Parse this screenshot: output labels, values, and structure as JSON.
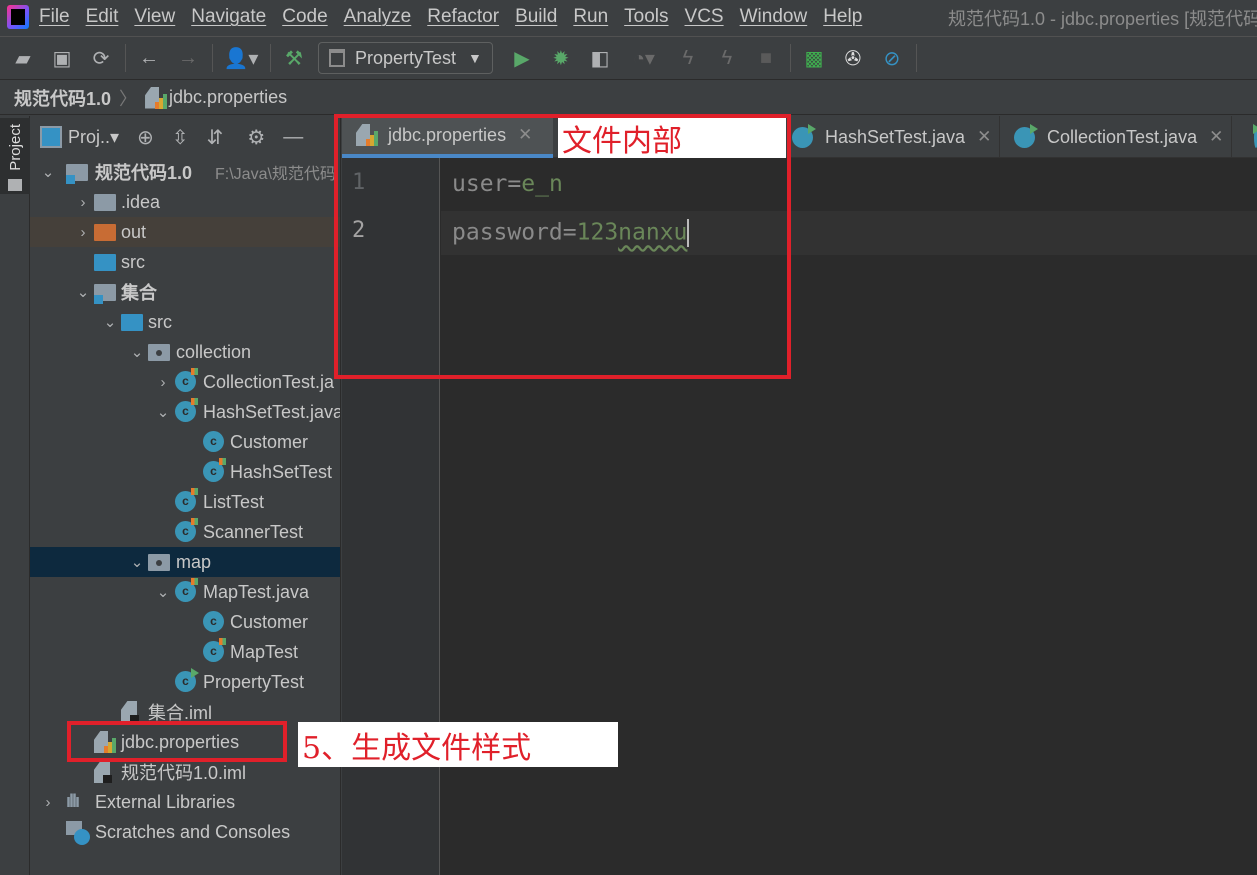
{
  "menubar": {
    "items": [
      "File",
      "Edit",
      "View",
      "Navigate",
      "Code",
      "Analyze",
      "Refactor",
      "Build",
      "Run",
      "Tools",
      "VCS",
      "Window",
      "Help"
    ],
    "window_title": "规范代码1.0 - jdbc.properties [规范代码"
  },
  "toolbar": {
    "run_config": "PropertyTest",
    "icons": [
      "open-icon",
      "save-icon",
      "sync-icon",
      "back-icon",
      "forward-icon",
      "user-icon",
      "build-icon",
      "run-icon",
      "debug-icon",
      "coverage-icon",
      "profile-icon",
      "attach-icon",
      "build-artifact-icon",
      "stop-icon",
      "monitor-icon",
      "plugins-icon",
      "no-icon"
    ]
  },
  "breadcrumb": {
    "project": "规范代码1.0",
    "file": "jdbc.properties"
  },
  "left_stripe": {
    "project_tab": "Project"
  },
  "project_panel": {
    "title": "Proj..▾",
    "tree": [
      {
        "label": "规范代码1.0",
        "path": "F:\\Java\\规范代码",
        "depth": 0,
        "expand": "open",
        "icon": "module-folder",
        "bold": true
      },
      {
        "label": ".idea",
        "depth": 1,
        "expand": "closed",
        "icon": "folder"
      },
      {
        "label": "out",
        "depth": 1,
        "expand": "closed",
        "icon": "folder-orange",
        "highlight": "out"
      },
      {
        "label": "src",
        "depth": 1,
        "expand": "none",
        "icon": "folder-src"
      },
      {
        "label": "集合",
        "depth": 1,
        "expand": "open",
        "icon": "module-folder",
        "bold": true
      },
      {
        "label": "src",
        "depth": 2,
        "expand": "open",
        "icon": "folder-src"
      },
      {
        "label": "collection",
        "depth": 3,
        "expand": "open",
        "icon": "package"
      },
      {
        "label": "CollectionTest.ja",
        "depth": 4,
        "expand": "closed",
        "icon": "class-mix"
      },
      {
        "label": "HashSetTest.java",
        "depth": 4,
        "expand": "open",
        "icon": "class-mix"
      },
      {
        "label": "Customer",
        "depth": 5,
        "expand": "none",
        "icon": "class"
      },
      {
        "label": "HashSetTest",
        "depth": 5,
        "expand": "none",
        "icon": "class-mix"
      },
      {
        "label": "ListTest",
        "depth": 4,
        "expand": "none",
        "icon": "class-mix"
      },
      {
        "label": "ScannerTest",
        "depth": 4,
        "expand": "none",
        "icon": "class-mix"
      },
      {
        "label": "map",
        "depth": 3,
        "expand": "open",
        "icon": "package",
        "highlight": "sel"
      },
      {
        "label": "MapTest.java",
        "depth": 4,
        "expand": "open",
        "icon": "class-mix"
      },
      {
        "label": "Customer",
        "depth": 5,
        "expand": "none",
        "icon": "class"
      },
      {
        "label": "MapTest",
        "depth": 5,
        "expand": "none",
        "icon": "class-mix"
      },
      {
        "label": "PropertyTest",
        "depth": 4,
        "expand": "none",
        "icon": "class-run"
      },
      {
        "label": "集合.iml",
        "depth": 2,
        "expand": "none",
        "icon": "iml"
      },
      {
        "label": "jdbc.properties",
        "depth": 1,
        "expand": "none",
        "icon": "properties"
      },
      {
        "label": "规范代码1.0.iml",
        "depth": 1,
        "expand": "none",
        "icon": "iml"
      },
      {
        "label": "External Libraries",
        "depth": 0,
        "expand": "closed",
        "icon": "libraries"
      },
      {
        "label": "Scratches and Consoles",
        "depth": 0,
        "expand": "none",
        "icon": "scratches"
      }
    ]
  },
  "editor": {
    "tabs": [
      {
        "label": "jdbc.properties",
        "active": true,
        "icon": "properties"
      },
      {
        "label": "HashSetTest.java",
        "icon": "class-run"
      },
      {
        "label": "CollectionTest.java",
        "icon": "class-run"
      }
    ],
    "lines": [
      {
        "num": "1",
        "key": "user=",
        "value": "e_n"
      },
      {
        "num": "2",
        "key": "password=",
        "value_plain": "123",
        "value_squiggle": "nanxu"
      }
    ]
  },
  "annotations": {
    "editor_note": "文件内部",
    "tree_note": "5、生成文件样式",
    "color": "#e0202a"
  }
}
